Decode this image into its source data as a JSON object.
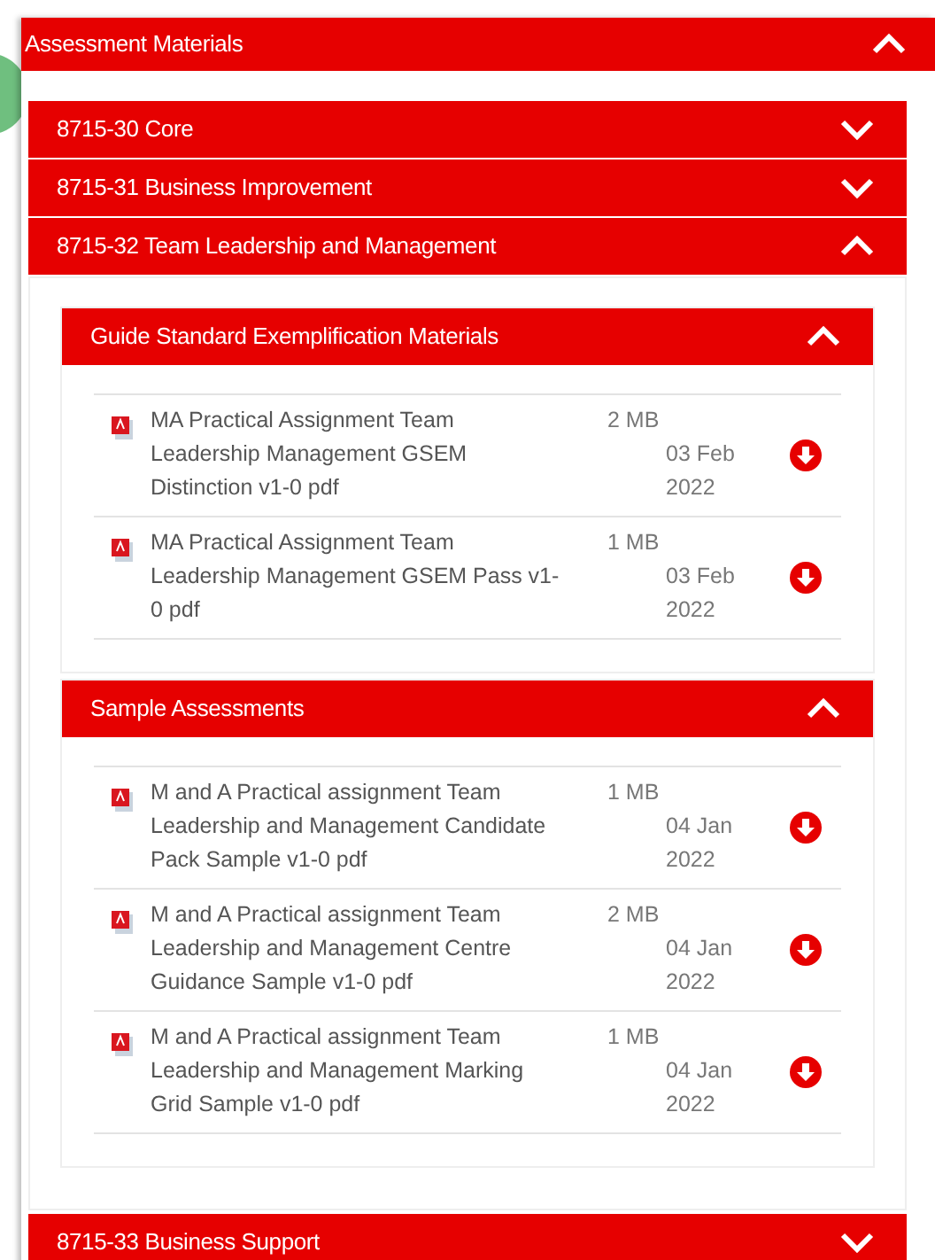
{
  "panel": {
    "title": "Assessment Materials",
    "expanded": true
  },
  "units": [
    {
      "title": "8715-30 Core",
      "expanded": false
    },
    {
      "title": "8715-31 Business Improvement",
      "expanded": false
    },
    {
      "title": "8715-32 Team Leadership and Management",
      "expanded": true,
      "groups": [
        {
          "title": "Guide Standard Exemplification Materials",
          "expanded": true,
          "files": [
            {
              "name": "MA Practical Assignment Team Leadership Management GSEM Distinction v1-0 pdf",
              "size": "2 MB",
              "date": "03 Feb 2022"
            },
            {
              "name": "MA Practical Assignment Team Leadership Management GSEM Pass v1-0 pdf",
              "size": "1 MB",
              "date": "03 Feb 2022"
            }
          ]
        },
        {
          "title": "Sample Assessments",
          "expanded": true,
          "files": [
            {
              "name": "M and A Practical assignment Team Leadership and Management Candidate Pack Sample v1-0 pdf",
              "size": "1 MB",
              "date": "04 Jan 2022"
            },
            {
              "name": "M and A Practical assignment Team Leadership and Management Centre Guidance Sample v1-0 pdf",
              "size": "2 MB",
              "date": "04 Jan 2022"
            },
            {
              "name": "M and A Practical assignment Team Leadership and Management Marking Grid Sample v1-0 pdf",
              "size": "1 MB",
              "date": "04 Jan 2022"
            }
          ]
        }
      ]
    },
    {
      "title": "8715-33 Business Support",
      "expanded": false
    }
  ]
}
